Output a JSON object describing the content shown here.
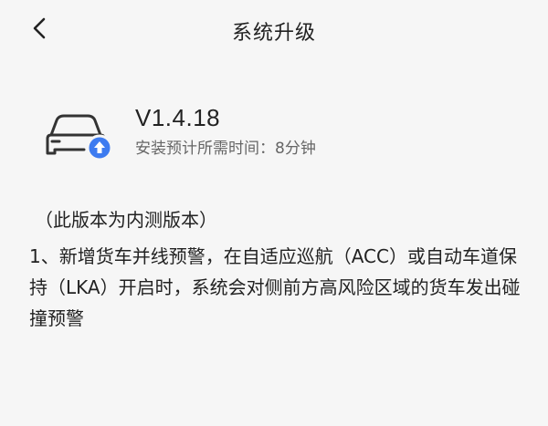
{
  "header": {
    "title": "系统升级",
    "back_icon": "chevron-left-icon"
  },
  "update": {
    "version": "V1.4.18",
    "install_time": "安装预计所需时间：8分钟",
    "car_icon": "car-upgrade-icon",
    "badge_icon": "arrow-up-icon",
    "accent_color": "#3d7bf0"
  },
  "release_notes": {
    "tag": "（此版本为内测版本）",
    "items": [
      "1、新增货车并线预警，在自适应巡航（ACC）或自动车道保持（LKA）开启时，系统会对侧前方高风险区域的货车发出碰撞预警"
    ]
  }
}
